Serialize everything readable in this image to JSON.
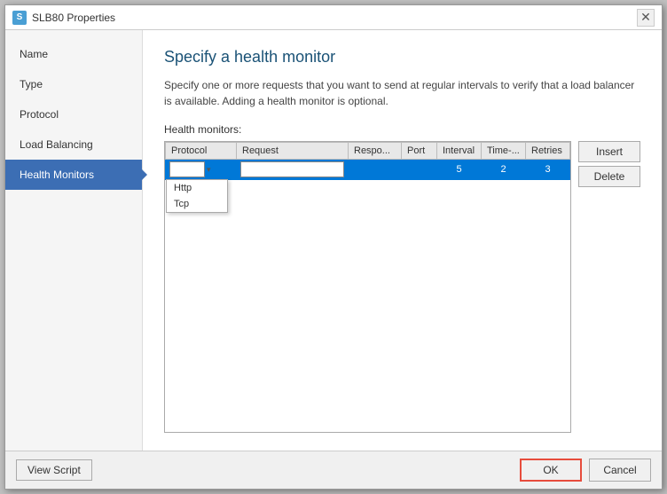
{
  "window": {
    "title": "SLB80 Properties",
    "close_label": "✕",
    "icon_label": "S"
  },
  "sidebar": {
    "items": [
      {
        "id": "name",
        "label": "Name"
      },
      {
        "id": "type",
        "label": "Type"
      },
      {
        "id": "protocol",
        "label": "Protocol"
      },
      {
        "id": "load-balancing",
        "label": "Load Balancing"
      },
      {
        "id": "health-monitors",
        "label": "Health Monitors"
      }
    ]
  },
  "main": {
    "title": "Specify a health monitor",
    "description": "Specify one or more requests that you want to send at regular intervals to verify that a load balancer is available. Adding a health monitor is optional.",
    "health_monitors_label": "Health monitors:",
    "table": {
      "columns": [
        {
          "id": "protocol",
          "label": "Protocol"
        },
        {
          "id": "request",
          "label": "Request"
        },
        {
          "id": "response",
          "label": "Respo..."
        },
        {
          "id": "port",
          "label": "Port"
        },
        {
          "id": "interval",
          "label": "Interval"
        },
        {
          "id": "timeout",
          "label": "Time-..."
        },
        {
          "id": "retries",
          "label": "Retries"
        }
      ],
      "rows": [
        {
          "protocol_value": "",
          "request_value": "",
          "response_value": "",
          "port_value": "",
          "interval_value": "5",
          "timeout_value": "2",
          "retries_value": "3",
          "selected": true
        }
      ],
      "dropdown_options": [
        "Http",
        "Tcp"
      ]
    },
    "buttons": {
      "insert": "Insert",
      "delete": "Delete"
    }
  },
  "footer": {
    "view_script": "View Script",
    "ok": "OK",
    "cancel": "Cancel"
  }
}
